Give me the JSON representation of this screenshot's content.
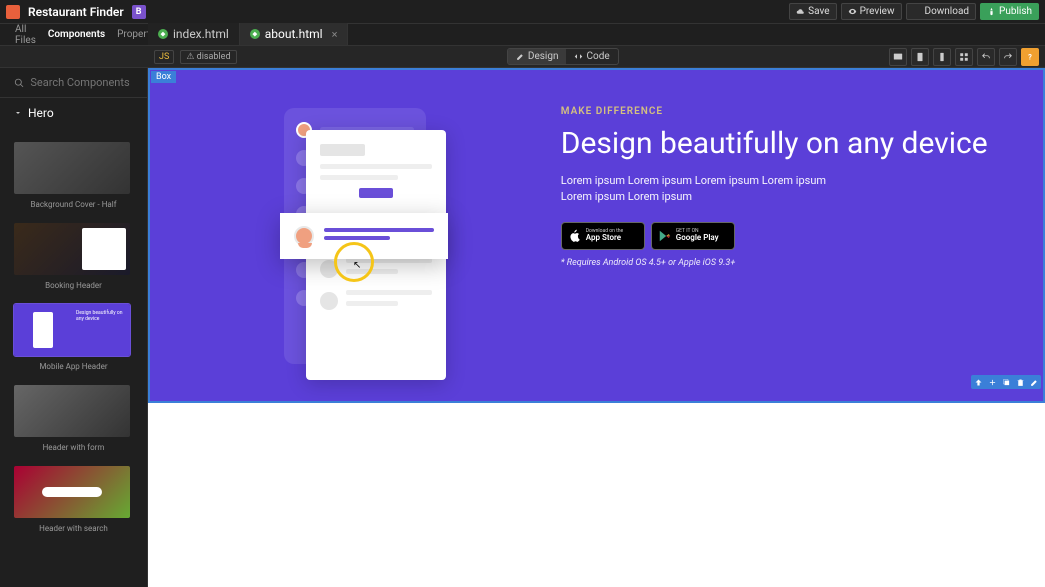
{
  "project": {
    "title": "Restaurant Finder",
    "framework_badge": "B"
  },
  "topbar": {
    "save": "Save",
    "preview": "Preview",
    "download": "Download",
    "publish": "Publish"
  },
  "side_tabs": {
    "all_files": "All Files",
    "components": "Components",
    "properties": "Properties"
  },
  "file_tabs": [
    {
      "name": "index.html"
    },
    {
      "name": "about.html"
    }
  ],
  "js_badge": "JS",
  "disabled_badge": "disabled",
  "view_switch": {
    "design": "Design",
    "code": "Code"
  },
  "search": {
    "placeholder": "Search Components"
  },
  "category": "Hero",
  "components": [
    {
      "label": "Background Cover - Half"
    },
    {
      "label": "Booking Header"
    },
    {
      "label": "Mobile App Header"
    },
    {
      "label": "Header with form"
    },
    {
      "label": "Header with search"
    }
  ],
  "box_tag": "Box",
  "hero": {
    "eyebrow": "MAKE DIFFERENCE",
    "heading": "Design beautifully on any device",
    "body": "Lorem ipsum Lorem ipsum Lorem ipsum Lorem ipsum Lorem ipsum Lorem ipsum",
    "appstore_sm": "Download on the",
    "appstore_lg": "App Store",
    "play_sm": "GET IT ON",
    "play_lg": "Google Play",
    "note": "* Requires Android OS 4.5+ or Apple iOS 9.3+"
  },
  "thumb3": "Design beautifully on any device"
}
